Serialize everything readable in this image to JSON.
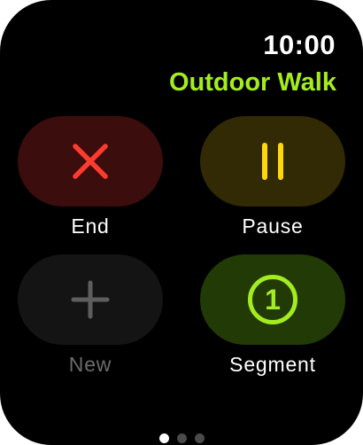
{
  "status": {
    "time": "10:00"
  },
  "workout": {
    "title": "Outdoor Walk"
  },
  "actions": {
    "end": {
      "label": "End",
      "icon": "close-x-icon",
      "color": "#ff3b30"
    },
    "pause": {
      "label": "Pause",
      "icon": "pause-icon",
      "color": "#ffd60a"
    },
    "new": {
      "label": "New",
      "icon": "plus-icon",
      "color": "#5e5e5e"
    },
    "segment": {
      "label": "Segment",
      "icon": "segment-1-icon",
      "number": "1",
      "color": "#a3ed1f"
    }
  },
  "pager": {
    "count": 3,
    "active_index": 0
  }
}
